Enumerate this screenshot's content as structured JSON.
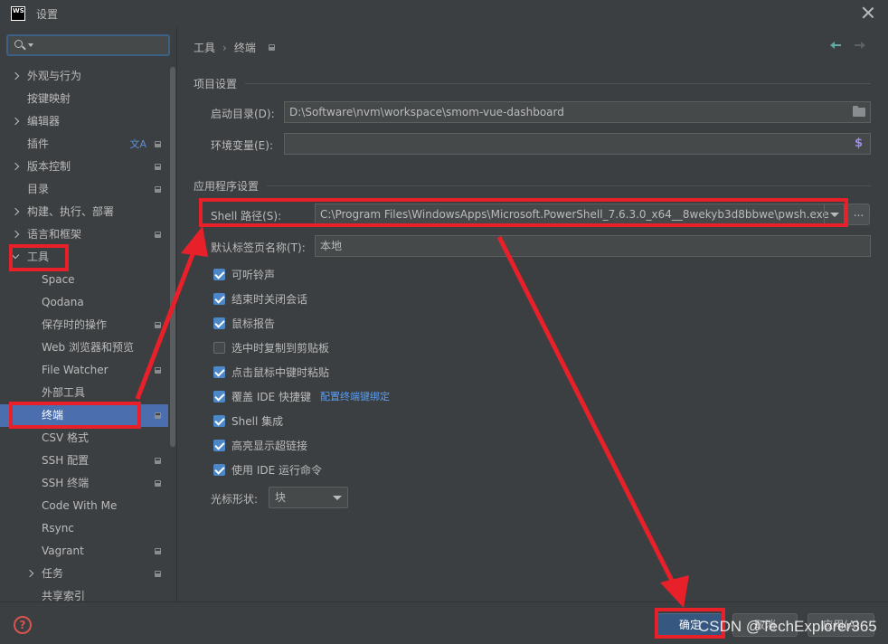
{
  "window": {
    "logo_text": "WS",
    "title": "设置"
  },
  "sidebar": {
    "search_placeholder": "",
    "items": [
      {
        "label": "外观与行为",
        "level": 0,
        "arrow": "right",
        "badge": false
      },
      {
        "label": "按键映射",
        "level": 0,
        "arrow": "none",
        "badge": false
      },
      {
        "label": "编辑器",
        "level": 0,
        "arrow": "right",
        "badge": false
      },
      {
        "label": "插件",
        "level": 0,
        "arrow": "none",
        "badge": true,
        "translate_icon": true
      },
      {
        "label": "版本控制",
        "level": 0,
        "arrow": "right",
        "badge": true
      },
      {
        "label": "目录",
        "level": 0,
        "arrow": "none",
        "badge": true
      },
      {
        "label": "构建、执行、部署",
        "level": 0,
        "arrow": "right",
        "badge": false
      },
      {
        "label": "语言和框架",
        "level": 0,
        "arrow": "right",
        "badge": true
      },
      {
        "label": "工具",
        "level": 0,
        "arrow": "down",
        "badge": false
      },
      {
        "label": "Space",
        "level": 1,
        "arrow": "none",
        "badge": false
      },
      {
        "label": "Qodana",
        "level": 1,
        "arrow": "none",
        "badge": false
      },
      {
        "label": "保存时的操作",
        "level": 1,
        "arrow": "none",
        "badge": true
      },
      {
        "label": "Web 浏览器和预览",
        "level": 1,
        "arrow": "none",
        "badge": false
      },
      {
        "label": "File Watcher",
        "level": 1,
        "arrow": "none",
        "badge": true
      },
      {
        "label": "外部工具",
        "level": 1,
        "arrow": "none",
        "badge": false
      },
      {
        "label": "终端",
        "level": 1,
        "arrow": "none",
        "badge": true,
        "selected": true
      },
      {
        "label": "CSV 格式",
        "level": 1,
        "arrow": "none",
        "badge": false
      },
      {
        "label": "SSH 配置",
        "level": 1,
        "arrow": "none",
        "badge": true
      },
      {
        "label": "SSH 终端",
        "level": 1,
        "arrow": "none",
        "badge": true
      },
      {
        "label": "Code With Me",
        "level": 1,
        "arrow": "none",
        "badge": false
      },
      {
        "label": "Rsync",
        "level": 1,
        "arrow": "none",
        "badge": false
      },
      {
        "label": "Vagrant",
        "level": 1,
        "arrow": "none",
        "badge": true
      },
      {
        "label": "任务",
        "level": 1,
        "arrow": "right",
        "badge": true
      },
      {
        "label": "共享索引",
        "level": 1,
        "arrow": "none",
        "badge": false
      }
    ]
  },
  "breadcrumb": {
    "parent": "工具",
    "separator": "›",
    "current": "终端"
  },
  "project_settings": {
    "title": "项目设置",
    "start_dir_label": "启动目录(D):",
    "start_dir_value": "D:\\Software\\nvm\\workspace\\smom-vue-dashboard",
    "env_label": "环境变量(E):",
    "env_value": ""
  },
  "app_settings": {
    "title": "应用程序设置",
    "shell_label": "Shell 路径(S):",
    "shell_value": "C:\\Program Files\\WindowsApps\\Microsoft.PowerShell_7.6.3.0_x64__8wekyb3d8bbwe\\pwsh.exe",
    "ellipsis": "...",
    "tab_name_label": "默认标签页名称(T):",
    "tab_name_value": "本地",
    "checkboxes": [
      {
        "label": "可听铃声",
        "checked": true
      },
      {
        "label": "结束时关闭会话",
        "checked": true
      },
      {
        "label": "鼠标报告",
        "checked": true
      },
      {
        "label": "选中时复制到剪贴板",
        "checked": false
      },
      {
        "label": "点击鼠标中键时粘贴",
        "checked": true
      },
      {
        "label": "覆盖 IDE 快捷键",
        "checked": true,
        "link": "配置终端键绑定"
      },
      {
        "label": "Shell 集成",
        "checked": true
      },
      {
        "label": "高亮显示超链接",
        "checked": true
      },
      {
        "label": "使用 IDE 运行命令",
        "checked": true
      }
    ],
    "cursor_shape_label": "光标形状:",
    "cursor_shape_value": "块"
  },
  "footer": {
    "help": "?",
    "ok": "确定",
    "cancel": "取消",
    "apply": "应用(A)"
  },
  "watermark": "CSDN @TechExplorer365",
  "colors": {
    "background": "#3c3f41",
    "selection": "#4b6eaf",
    "accent_blue": "#4c87c8",
    "link": "#589df6",
    "annotation_red": "#e8202a"
  }
}
